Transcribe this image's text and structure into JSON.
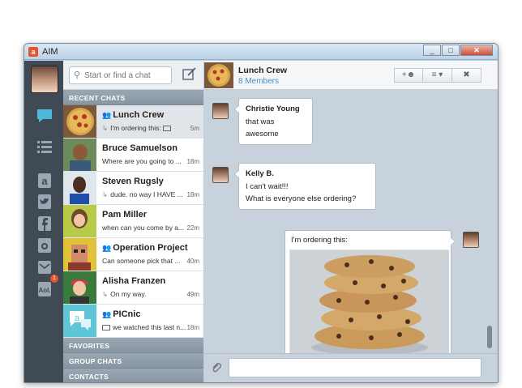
{
  "window": {
    "app_title": "AIM",
    "app_icon": "aim-logo-icon",
    "buttons": [
      "_",
      "□",
      "✕"
    ]
  },
  "rail": {
    "icons": [
      "chat-bubble-icon",
      "list-icon",
      "aim-icon",
      "twitter-icon",
      "facebook-icon",
      "instagram-icon",
      "mail-icon",
      "aol-icon"
    ],
    "mail_badge": "1"
  },
  "search": {
    "placeholder": "Start or find a chat"
  },
  "sections": {
    "recent": "RECENT CHATS",
    "favorites": "FAVORITES",
    "group": "GROUP CHATS",
    "contacts": "CONTACTS"
  },
  "chats": [
    {
      "name": "Lunch Crew",
      "group": true,
      "preview": "I'm ordering this:",
      "time": "5m",
      "reply": true,
      "image": true
    },
    {
      "name": "Bruce Samuelson",
      "group": false,
      "preview": "Where are you going to ...",
      "time": "18m",
      "reply": false
    },
    {
      "name": "Steven Rugsly",
      "group": false,
      "preview": "dude. no way I HAVE ...",
      "time": "18m",
      "reply": true
    },
    {
      "name": "Pam Miller",
      "group": false,
      "preview": "when can you come by a...",
      "time": "22m",
      "reply": false
    },
    {
      "name": "Operation Project",
      "group": true,
      "preview": "Can someone pick that ...",
      "time": "40m",
      "reply": false
    },
    {
      "name": "Alisha Franzen",
      "group": false,
      "preview": "On my way.",
      "time": "49m",
      "reply": true
    },
    {
      "name": "PICnic",
      "group": true,
      "preview": "we watched this last n...",
      "time": "18m",
      "reply": false,
      "image": true
    }
  ],
  "header": {
    "title": "Lunch Crew",
    "members": "8 Members"
  },
  "messages": [
    {
      "sender": "Christie Young",
      "lines": [
        "that was awesome"
      ]
    },
    {
      "sender": "Kelly B.",
      "lines": [
        "I can't wait!!!",
        "What is everyone else ordering?"
      ]
    },
    {
      "sender": "",
      "lines": [
        "I'm ordering this:"
      ],
      "self": true
    }
  ],
  "separator": "• •",
  "input": {
    "value": ""
  },
  "colors": {
    "accent": "#4a90c2",
    "rail": "#3f4a55",
    "badge": "#e8542a"
  }
}
